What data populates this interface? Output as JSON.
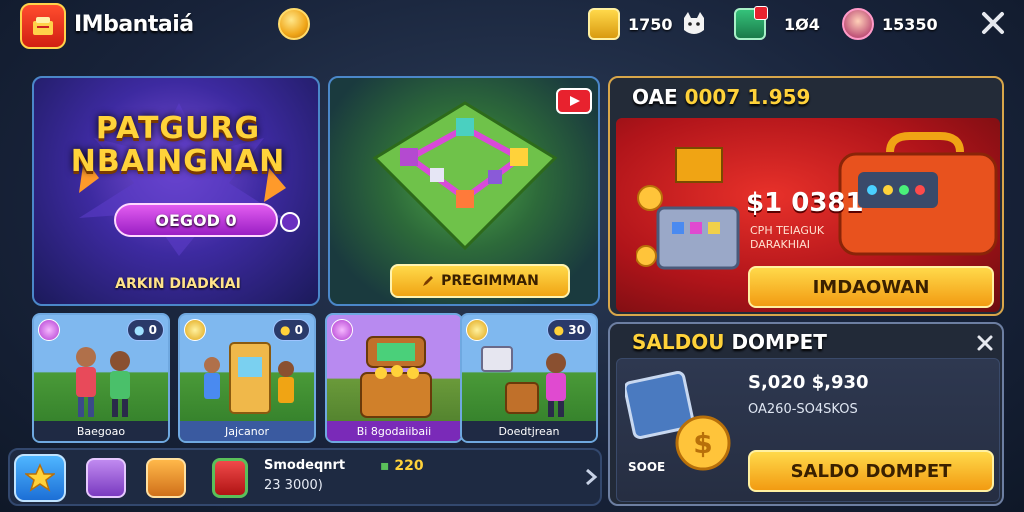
{
  "topbar": {
    "brand": "IMbantaiá",
    "resources": [
      {
        "icon": "gem-crate-icon",
        "value": "1750"
      },
      {
        "icon": "cat-icon",
        "value": ""
      },
      {
        "icon": "ticket-box-icon",
        "value": "1Ø4"
      },
      {
        "icon": "avatar-icon",
        "value": "15350"
      }
    ]
  },
  "promo_left": {
    "title_line1": "PATGURG",
    "title_line2": "NBAINGNAN",
    "pill": "OEGOD 0",
    "subtitle": "ARKIN DIADKIAI"
  },
  "board": {
    "button": "PREGIMMAN"
  },
  "offer": {
    "header_white": "OAE",
    "header_gold": "0007 1.959",
    "price": "$1 0381",
    "desc_line1": "CPH TEIAGUK",
    "desc_line2": "DARAKHIAI",
    "button": "IMDAOWAN"
  },
  "cards": [
    {
      "label": "Baegoao",
      "badge": "0"
    },
    {
      "label": "Jajcanor",
      "badge": "0"
    },
    {
      "label": "Bi 8godaiibaii",
      "badge": ""
    },
    {
      "label": "Doedtjrean",
      "badge": "30"
    }
  ],
  "bottombar": {
    "title": "Smodeqnrt",
    "subtitle": "23 3000)",
    "count": "220"
  },
  "wallet": {
    "header_gold": "SALDOU",
    "header_white": "DOMPET",
    "amount": "S,020 $,930",
    "code": "OA260-SO4SKOS",
    "item_label": "SOOE",
    "button": "SALDO DOMPET"
  },
  "colors": {
    "gold": "#ffd23a",
    "accent_blue": "#4b87c9",
    "offer_red": "#b0141a"
  }
}
